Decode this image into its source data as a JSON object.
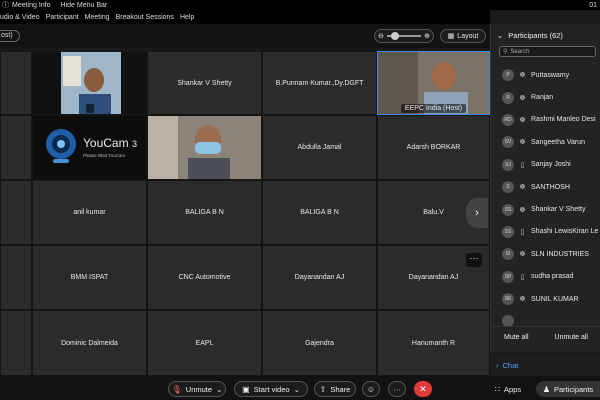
{
  "titlebar": {
    "meeting_info": "Meeting Info",
    "hide_menu_bar": "Hide Menu Bar",
    "right_fragment": "01"
  },
  "menu": [
    "udio & Video",
    "Participant",
    "Meeting",
    "Breakout Sessions",
    "Help"
  ],
  "toolbar": {
    "host_chip": "ost)",
    "layout_label": "Layout",
    "zoom_minus": "⊖",
    "zoom_plus": "⊕"
  },
  "tiles": [
    {
      "label": "",
      "video": true
    },
    {
      "label": "Shankar V Shetty"
    },
    {
      "label": "B.Punnam Kumar.,Dy.DGFT"
    },
    {
      "label": "EEPC India (Host)",
      "video": true,
      "host": true
    },
    {
      "label": "",
      "video": true,
      "logo": "YouCam 3"
    },
    {
      "label": "",
      "video": true
    },
    {
      "label": "Abdulla Jamal"
    },
    {
      "label": "Adarsh BORKAR"
    },
    {
      "label": "anil kumar"
    },
    {
      "label": "BALIGA B N"
    },
    {
      "label": "BALIGA B N"
    },
    {
      "label": "Balu.V"
    },
    {
      "label": "BMM ISPAT"
    },
    {
      "label": "CNC Automotive"
    },
    {
      "label": "Dayanandan AJ"
    },
    {
      "label": "Dayanandan AJ"
    },
    {
      "label": "Dominic Dalmeida"
    },
    {
      "label": "EAPL"
    },
    {
      "label": "Gajendra"
    },
    {
      "label": "Hanumanth R"
    }
  ],
  "youcam": {
    "brand": "YouCam",
    "version": "3",
    "note": "Please Wait YouCam"
  },
  "panel": {
    "title": "Participants (62)",
    "search_placeholder": "Search",
    "participants": [
      {
        "initials": "P",
        "name": "Puttaswamy",
        "device": "headset"
      },
      {
        "initials": "R",
        "name": "Ranjan",
        "device": "headset"
      },
      {
        "initials": "RD",
        "name": "Rashmi Manleo Desi",
        "device": "headset"
      },
      {
        "initials": "SV",
        "name": "Sangeetha Varun",
        "device": "headset"
      },
      {
        "initials": "SJ",
        "name": "Sanjay Joshi",
        "device": "phone"
      },
      {
        "initials": "S",
        "name": "SANTHOSH",
        "device": "headset"
      },
      {
        "initials": "SS",
        "name": "Shankar V Shetty",
        "device": "headset"
      },
      {
        "initials": "SS",
        "name": "Shashi LewisKiran Le",
        "device": "phone"
      },
      {
        "initials": "SI",
        "name": "SLN INDUSTRIES",
        "device": "headset"
      },
      {
        "initials": "SP",
        "name": "sudha prasad",
        "device": "phone"
      },
      {
        "initials": "SK",
        "name": "SUNIL KUMAR",
        "device": "headset"
      },
      {
        "initials": "",
        "name": "",
        "device": ""
      }
    ],
    "mute_all": "Mute all",
    "unmute_all": "Unmute all",
    "chat": "Chat"
  },
  "bottombar": {
    "unmute": "Unmute",
    "start_video": "Start video",
    "share": "Share",
    "more": "···",
    "end": "✕",
    "apps": "Apps",
    "participants": "Participants"
  },
  "colors": {
    "accent": "#3e8ef0",
    "end": "#e03a3a",
    "chat": "#4ea1ff",
    "mute": "#ff6a6a"
  }
}
